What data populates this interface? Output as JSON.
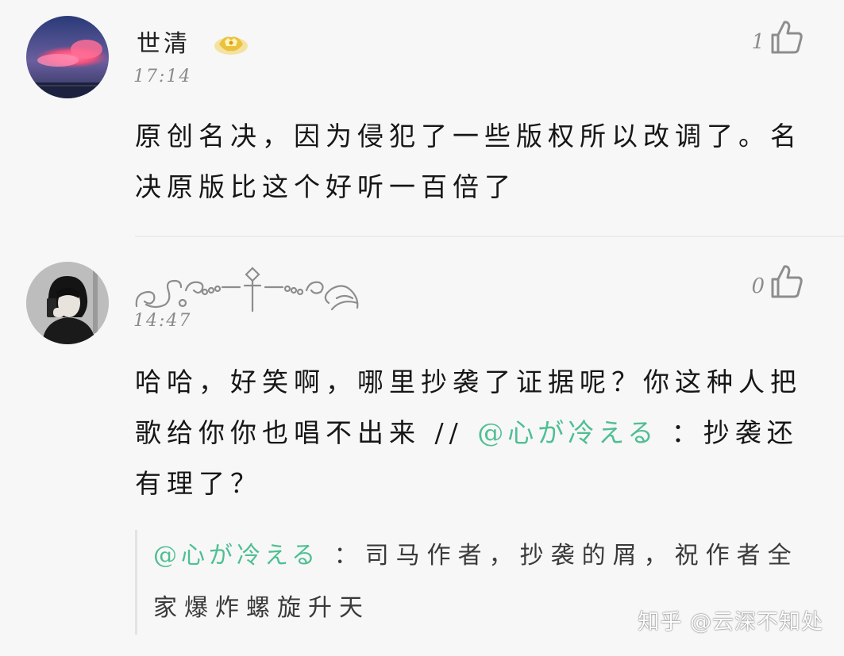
{
  "comments": [
    {
      "username": "世清",
      "badge_icon": "golden-crown-badge-icon",
      "time": "17:14",
      "likes": "1",
      "text": "原创名决，因为侵犯了一些版权所以改调了。名决原版比这个好听一百倍了"
    },
    {
      "username_icon": "ornamental-flourish-name-icon",
      "time": "14:47",
      "likes": "0",
      "text_before": "哈哈，好笑啊，哪里抄袭了证据呢？你这种人把歌给你你也唱不出来 // ",
      "mention": "@心が冷える",
      "text_after": " ：抄袭还有理了？",
      "quote": {
        "mention": "@心が冷える",
        "text": " ：司马作者，抄袭的屑，祝作者全家爆炸螺旋升天"
      }
    }
  ],
  "watermark": "知乎 @云深不知处",
  "colors": {
    "background": "#f7f7f7",
    "mention": "#4fbf92",
    "muted": "#8a8a8a"
  }
}
